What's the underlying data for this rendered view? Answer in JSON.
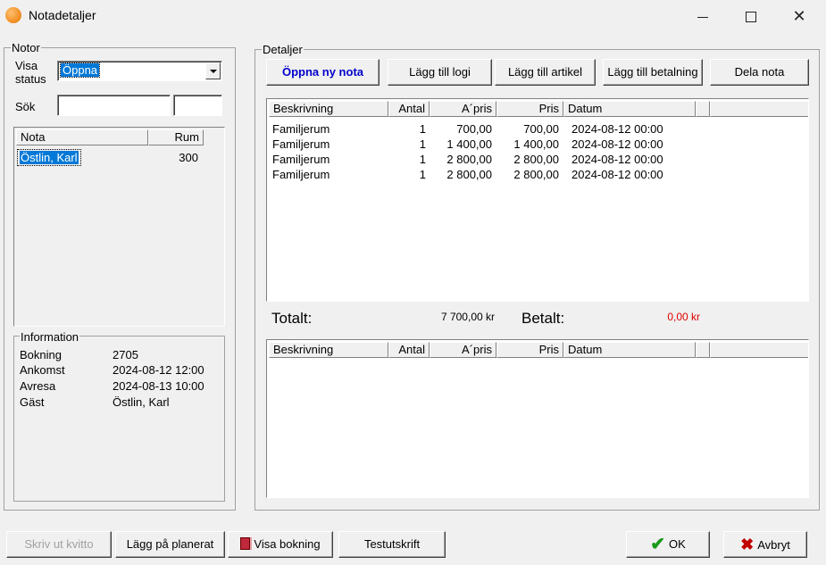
{
  "window": {
    "title": "Notadetaljer"
  },
  "notor": {
    "legend": "Notor",
    "visa_status_label_1": "Visa",
    "visa_status_label_2": "status",
    "status_value": "Öppna",
    "sok_label": "Sök",
    "sok_value": "",
    "sok_value2": "",
    "list_headers": [
      "Nota",
      "Rum"
    ],
    "list_rows": [
      {
        "nota": "Östlin, Karl",
        "rum": "300"
      }
    ]
  },
  "information": {
    "legend": "Information",
    "rows": [
      {
        "label": "Bokning",
        "value": "2705"
      },
      {
        "label": "Ankomst",
        "value": "2024-08-12 12:00"
      },
      {
        "label": "Avresa",
        "value": "2024-08-13 10:00"
      },
      {
        "label": "Gäst",
        "value": "Östlin, Karl"
      }
    ]
  },
  "detaljer": {
    "legend": "Detaljer",
    "buttons": {
      "oppna_ny_nota": "Öppna ny nota",
      "lagg_till_logi": "Lägg till logi",
      "lagg_till_artikel": "Lägg till artikel",
      "lagg_till_betalning": "Lägg till betalning",
      "dela_nota": "Dela nota"
    },
    "headers": [
      "Beskrivning",
      "Antal",
      "A´pris",
      "Pris",
      "Datum"
    ],
    "rows": [
      {
        "beskrivning": "Familjerum",
        "antal": "1",
        "apris": "700,00",
        "pris": "700,00",
        "datum": "2024-08-12 00:00"
      },
      {
        "beskrivning": "Familjerum",
        "antal": "1",
        "apris": "1 400,00",
        "pris": "1 400,00",
        "datum": "2024-08-12 00:00"
      },
      {
        "beskrivning": "Familjerum",
        "antal": "1",
        "apris": "2 800,00",
        "pris": "2 800,00",
        "datum": "2024-08-12 00:00"
      },
      {
        "beskrivning": "Familjerum",
        "antal": "1",
        "apris": "2 800,00",
        "pris": "2 800,00",
        "datum": "2024-08-12 00:00"
      }
    ],
    "totalt_label": "Totalt:",
    "totalt_value": "7 700,00 kr",
    "betalt_label": "Betalt:",
    "betalt_value": "0,00 kr",
    "betalt_color": "#e00000",
    "payments_headers": [
      "Beskrivning",
      "Antal",
      "A´pris",
      "Pris",
      "Datum"
    ]
  },
  "footer": {
    "skriv_ut_kvitto": "Skriv ut kvitto",
    "lagg_pa_planerat": "Lägg på planerat",
    "visa_bokning": "Visa bokning",
    "testutskrift": "Testutskrift",
    "ok": "OK",
    "avbryt": "Avbryt"
  },
  "icons": {
    "app": "app-orb-icon",
    "minimize": "minimize-icon",
    "maximize": "maximize-icon",
    "close": "close-icon",
    "book": "book-icon",
    "check": "checkmark-icon",
    "cross": "cross-icon"
  }
}
